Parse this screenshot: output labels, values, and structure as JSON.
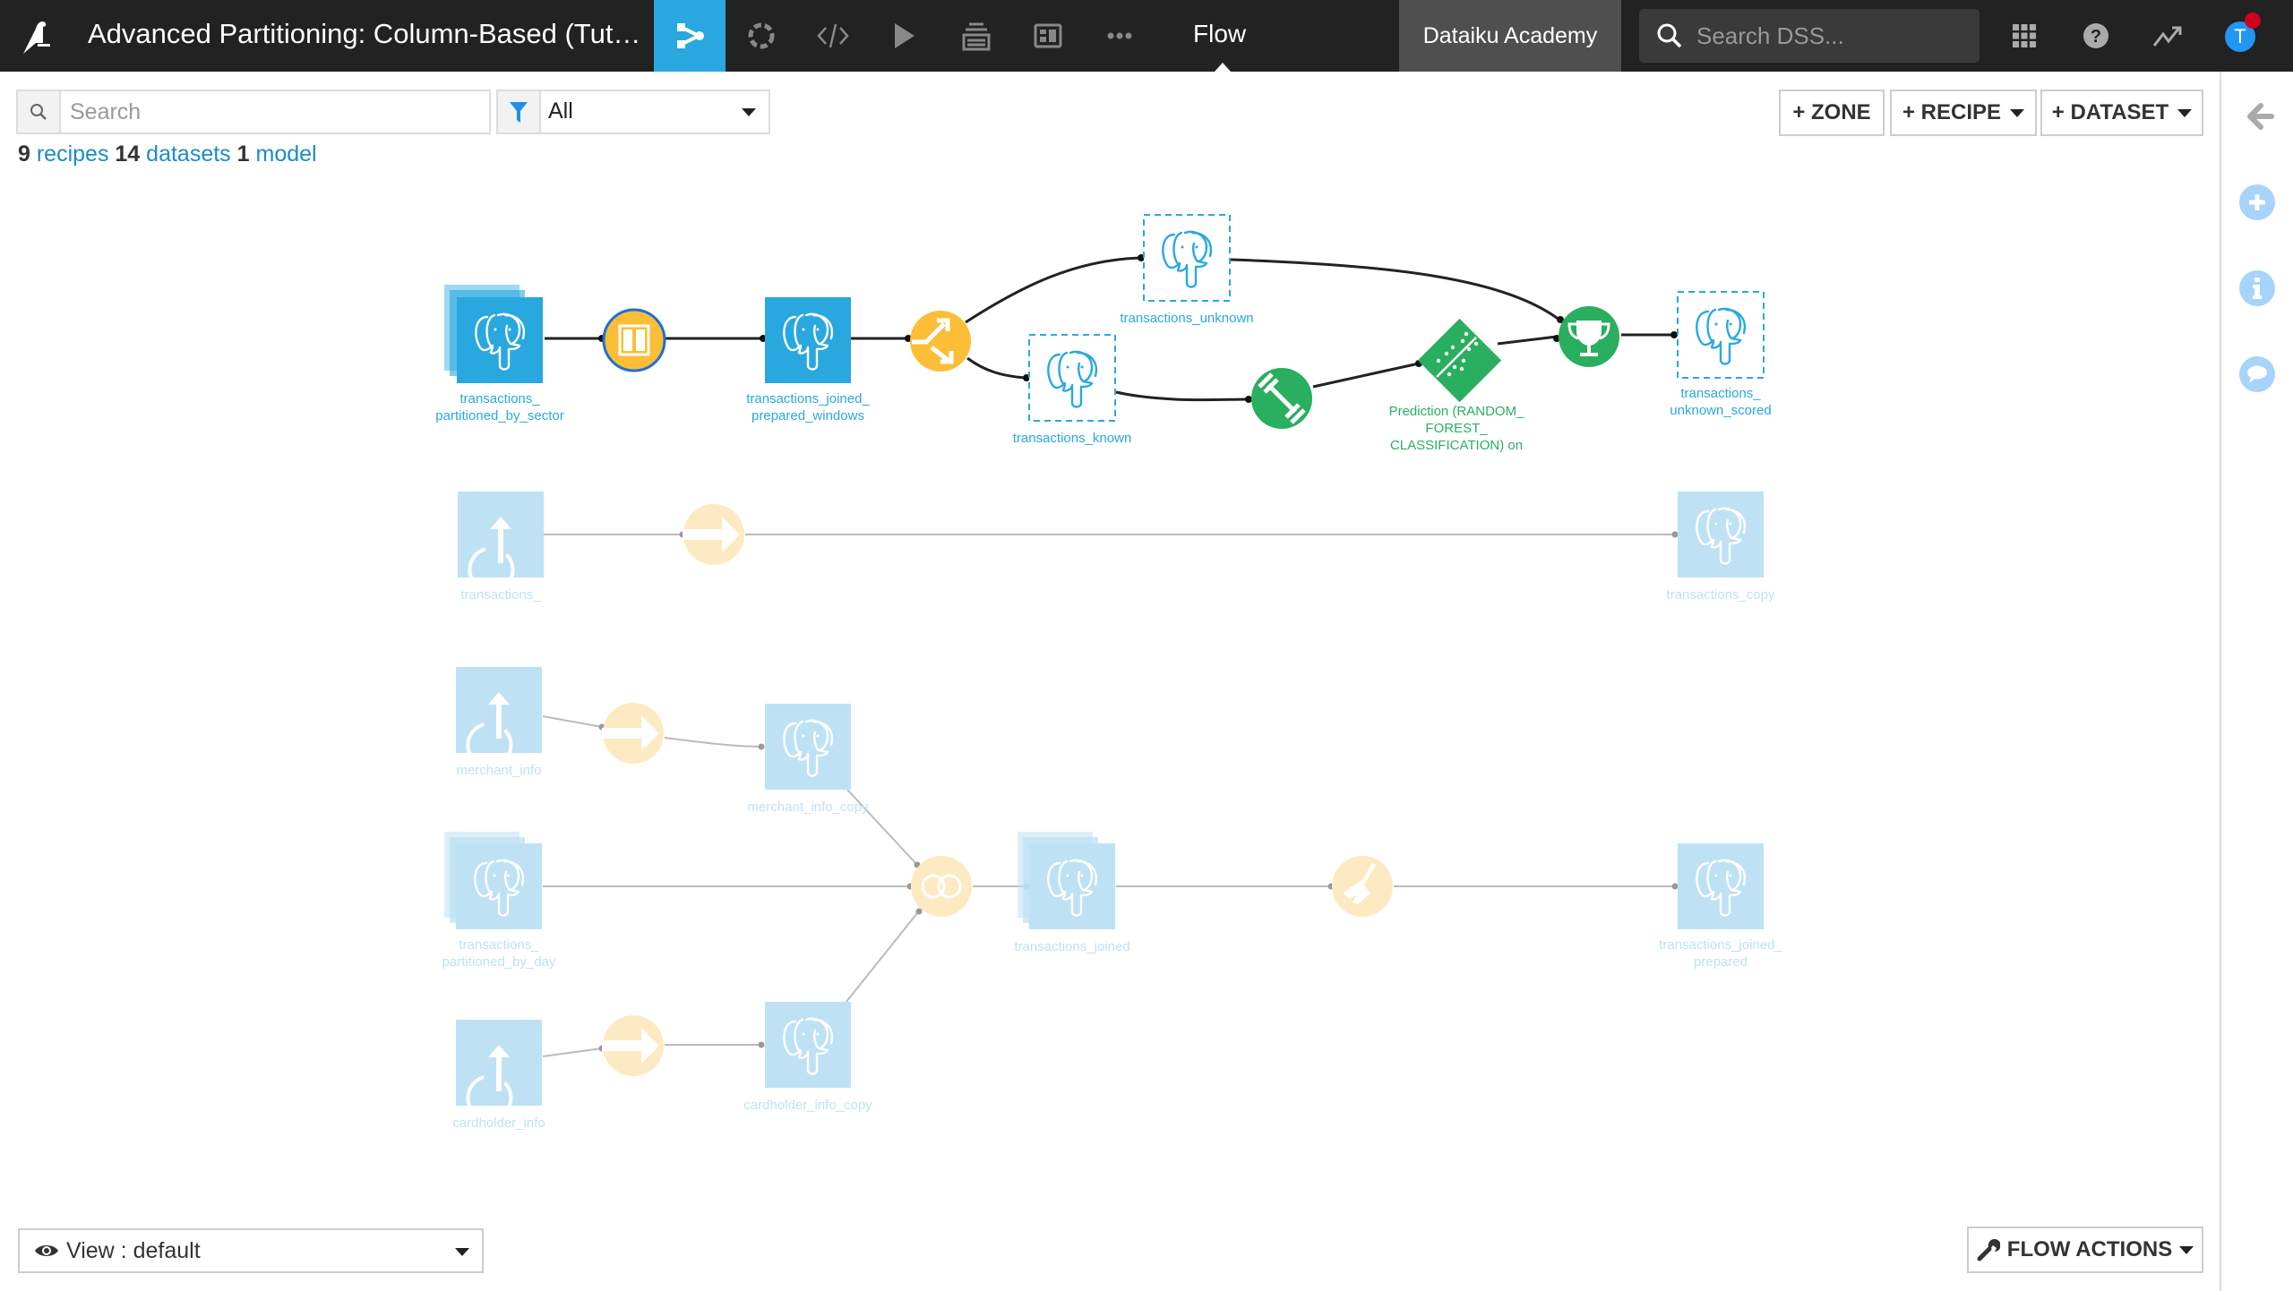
{
  "topbar": {
    "project_title": "Advanced Partitioning: Column-Based (Tut…",
    "nav_icons": [
      "flow-icon",
      "lab-icon",
      "code-icon",
      "run-icon",
      "datasets-stack-icon",
      "dashboard-icon",
      "more-icon"
    ],
    "current_section": "Flow",
    "instance_name": "Dataiku Academy",
    "search_placeholder": "Search DSS...",
    "avatar_initial": "T",
    "accent_color": "#29a8df"
  },
  "toolbar": {
    "search_placeholder": "Search",
    "filter_value": "All",
    "counts": {
      "recipes_num": "9",
      "recipes_label": "recipes",
      "datasets_num": "14",
      "datasets_label": "datasets",
      "models_num": "1",
      "models_label": "model"
    },
    "zone_button": "+ ZONE",
    "recipe_button": "+ RECIPE",
    "dataset_button": "+ DATASET"
  },
  "right_panel": {
    "icons": [
      "back-arrow-icon",
      "add-icon",
      "info-icon",
      "discussion-icon"
    ]
  },
  "flow": {
    "colors": {
      "dataset": "#29a8df",
      "dataset_faded": "#bee2f4",
      "recipe": "#fbbe36",
      "recipe_faded": "#fdeac2",
      "ml": "#2aae5f"
    },
    "datasets": [
      {
        "id": "tps",
        "label": [
          "transactions_",
          "partitioned_by_sector"
        ],
        "type": "postgres",
        "partitioned": true,
        "faded": false
      },
      {
        "id": "tjpw",
        "label": [
          "transactions_joined_",
          "prepared_windows"
        ],
        "type": "postgres",
        "faded": false
      },
      {
        "id": "tu",
        "label": [
          "transactions_unknown"
        ],
        "type": "postgres",
        "virtual": true,
        "faded": false
      },
      {
        "id": "tk",
        "label": [
          "transactions_known"
        ],
        "type": "postgres",
        "virtual": true,
        "faded": false
      },
      {
        "id": "tus",
        "label": [
          "transactions_",
          "unknown_scored"
        ],
        "type": "postgres",
        "virtual": true,
        "faded": false
      },
      {
        "id": "t_up",
        "label": [
          "transactions_"
        ],
        "type": "upload",
        "faded": true
      },
      {
        "id": "tcopy",
        "label": [
          "transactions_copy"
        ],
        "type": "postgres",
        "faded": true
      },
      {
        "id": "mi",
        "label": [
          "merchant_info"
        ],
        "type": "upload",
        "faded": true
      },
      {
        "id": "mic",
        "label": [
          "merchant_info_copy"
        ],
        "type": "postgres",
        "faded": true
      },
      {
        "id": "tpd",
        "label": [
          "transactions_",
          "partitioned_by_day"
        ],
        "type": "postgres",
        "partitioned": true,
        "faded": true
      },
      {
        "id": "tj",
        "label": [
          "transactions_joined"
        ],
        "type": "postgres",
        "partitioned": true,
        "faded": true
      },
      {
        "id": "tjp",
        "label": [
          "transactions_joined_",
          "prepared"
        ],
        "type": "postgres",
        "faded": true
      },
      {
        "id": "ci",
        "label": [
          "cardholder_info"
        ],
        "type": "upload",
        "faded": true
      },
      {
        "id": "cic",
        "label": [
          "cardholder_info_copy"
        ],
        "type": "postgres",
        "faded": true
      }
    ],
    "recipes": [
      {
        "id": "r_window",
        "kind": "window",
        "faded": false,
        "selected": true
      },
      {
        "id": "r_split",
        "kind": "split",
        "faded": false
      },
      {
        "id": "r_train",
        "kind": "train",
        "faded": false
      },
      {
        "id": "r_score",
        "kind": "score",
        "faded": false
      },
      {
        "id": "r_sync1",
        "kind": "sync",
        "faded": true
      },
      {
        "id": "r_sync2",
        "kind": "sync",
        "faded": true
      },
      {
        "id": "r_join",
        "kind": "join",
        "faded": true
      },
      {
        "id": "r_prepare",
        "kind": "prepare",
        "faded": true
      },
      {
        "id": "r_sync3",
        "kind": "sync",
        "faded": true
      }
    ],
    "models": [
      {
        "id": "m_pred",
        "label": [
          "Prediction (RANDOM_",
          "FOREST_",
          "CLASSIFICATION) on"
        ]
      }
    ]
  },
  "bottom": {
    "view_label": "View : default",
    "flow_actions_label": "FLOW ACTIONS"
  }
}
